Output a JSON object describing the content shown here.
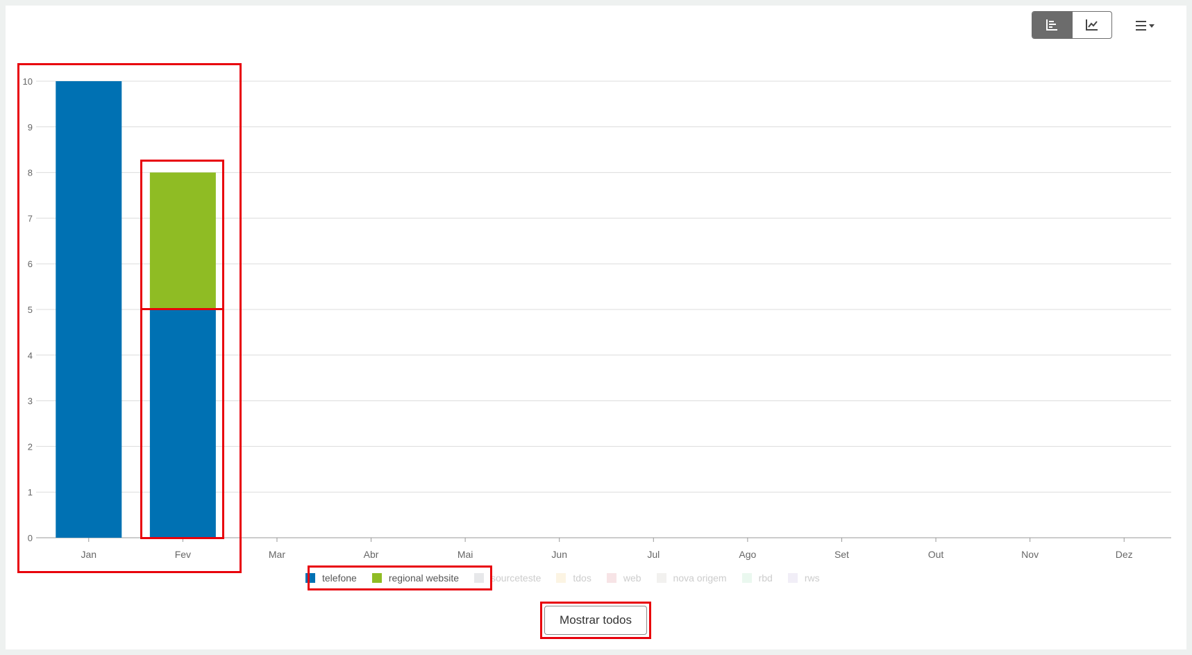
{
  "toolbar": {
    "bar_icon": "bar-chart-icon",
    "line_icon": "line-chart-icon",
    "menu_icon": "hamburger-menu-icon"
  },
  "chart_data": {
    "type": "bar",
    "stacked": true,
    "title": "",
    "xlabel": "",
    "ylabel": "",
    "ylim": [
      0,
      10
    ],
    "yticks": [
      0,
      1,
      2,
      3,
      4,
      5,
      6,
      7,
      8,
      9,
      10
    ],
    "grid": true,
    "legend_position": "bottom",
    "categories": [
      "Jan",
      "Fev",
      "Mar",
      "Abr",
      "Mai",
      "Jun",
      "Jul",
      "Ago",
      "Set",
      "Out",
      "Nov",
      "Dez"
    ],
    "series": [
      {
        "name": "telefone",
        "color": "#0071b3",
        "visible": true,
        "values": [
          10,
          5,
          0,
          0,
          0,
          0,
          0,
          0,
          0,
          0,
          0,
          0
        ]
      },
      {
        "name": "regional website",
        "color": "#8fbc24",
        "visible": true,
        "values": [
          0,
          3,
          0,
          0,
          0,
          0,
          0,
          0,
          0,
          0,
          0,
          0
        ]
      },
      {
        "name": "sourceteste",
        "color": "#b9bcc3",
        "visible": false,
        "values": []
      },
      {
        "name": "tdos",
        "color": "#f7dfb0",
        "visible": false,
        "values": []
      },
      {
        "name": "web",
        "color": "#e9b2b6",
        "visible": false,
        "values": []
      },
      {
        "name": "nova origem",
        "color": "#d9d6d0",
        "visible": false,
        "values": []
      },
      {
        "name": "rbd",
        "color": "#c2ecd0",
        "visible": false,
        "values": []
      },
      {
        "name": "rws",
        "color": "#d6cfe9",
        "visible": false,
        "values": []
      }
    ]
  },
  "show_all_label": "Mostrar todos"
}
